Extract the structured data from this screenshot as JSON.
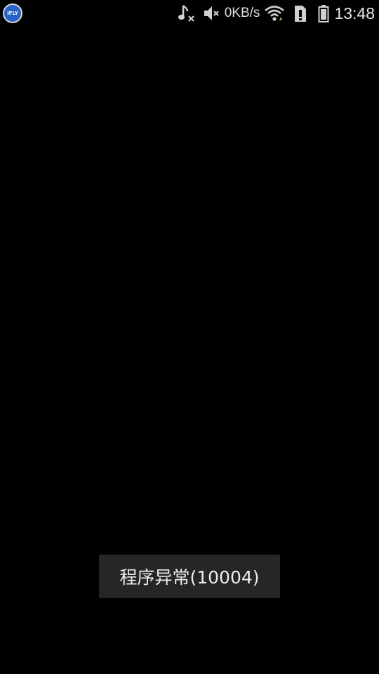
{
  "status_bar": {
    "app_logo_text": "iFLY",
    "net_speed": "0KB/s",
    "time": "13:48",
    "icons": [
      "ifly-logo-icon",
      "music-muted-icon",
      "volume-muted-icon",
      "wifi-icon",
      "sim-alert-icon",
      "battery-icon"
    ]
  },
  "toast": {
    "message": "程序异常(10004)"
  },
  "colors": {
    "background": "#000000",
    "toast_background": "#262626",
    "logo_blue": "#2a62c9"
  }
}
